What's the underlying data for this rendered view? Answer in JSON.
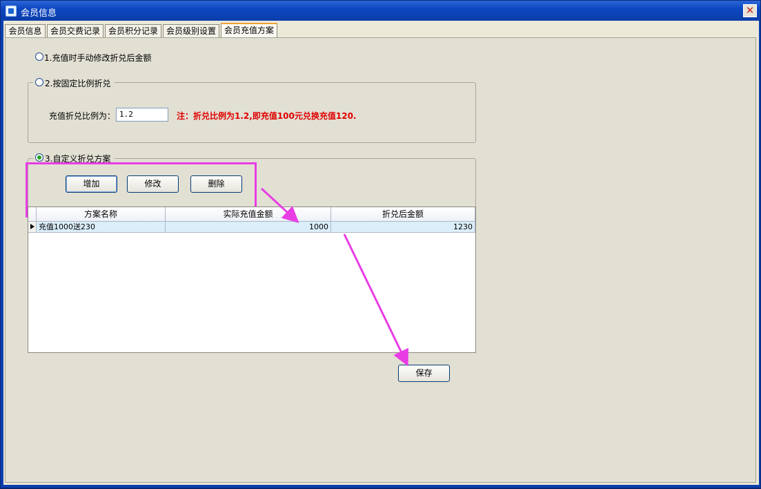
{
  "window": {
    "title": "会员信息",
    "close_glyph": "✕"
  },
  "tabs": [
    {
      "label": "会员信息"
    },
    {
      "label": "会员交费记录"
    },
    {
      "label": "会员积分记录"
    },
    {
      "label": "会员级别设置"
    },
    {
      "label": "会员充值方案",
      "active": true
    }
  ],
  "options": {
    "opt1_label": "1.充值时手动修改折兑后金额",
    "opt2_label": "2.按固定比例折兑",
    "ratio_label": "充值折兑比例为：",
    "ratio_value": "1.2",
    "ratio_note": "注：折兑比例为1.2,即充值100元兑换充值120.",
    "opt3_label": "3.自定义折兑方案",
    "selected": 3
  },
  "buttons": {
    "add": "增加",
    "edit": "修改",
    "delete": "删除",
    "save": "保存"
  },
  "grid": {
    "headers": [
      "方案名称",
      "实际充值金额",
      "折兑后金额"
    ],
    "rows": [
      {
        "name": "充值1000送230",
        "actual": "1000",
        "after": "1230"
      }
    ]
  },
  "colors": {
    "highlight": "#e83de4",
    "note": "#e00000"
  }
}
